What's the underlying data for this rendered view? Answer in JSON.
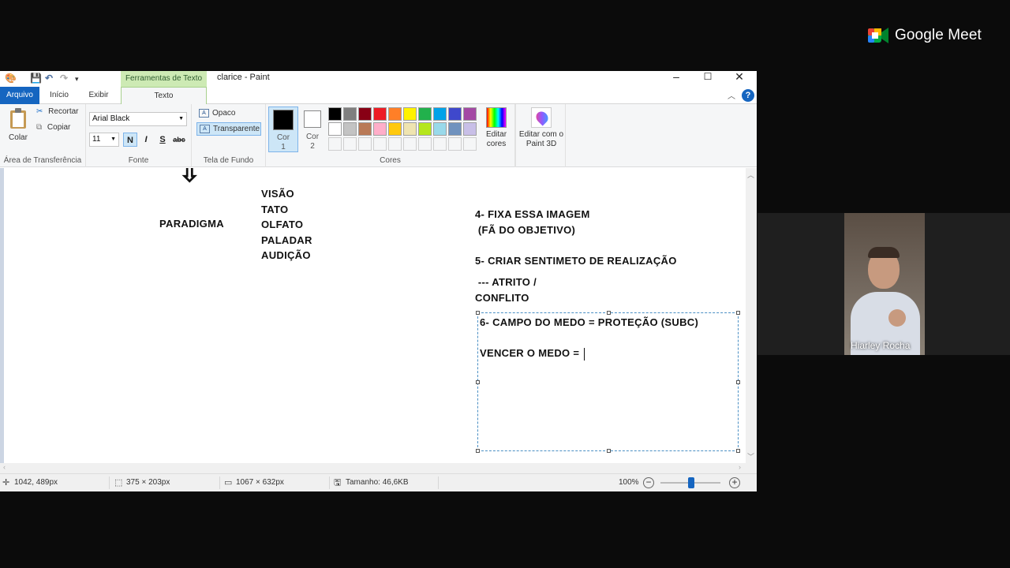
{
  "meet": {
    "brand": "Google Meet",
    "participant_name": "Hiarley Rocha"
  },
  "window": {
    "title": "clarice - Paint",
    "context_tab": "Ferramentas de Texto"
  },
  "tabs": {
    "file": "Arquivo",
    "home": "Início",
    "view": "Exibir",
    "text": "Texto"
  },
  "clipboard": {
    "paste": "Colar",
    "cut": "Recortar",
    "copy": "Copiar",
    "group_label": "Área de Transferência"
  },
  "font": {
    "family": "Arial Black",
    "size": "11",
    "bold": "N",
    "italic": "I",
    "underline": "S",
    "strike": "abc",
    "group_label": "Fonte"
  },
  "background": {
    "opaque": "Opaco",
    "transparent": "Transparente",
    "group_label": "Tela de Fundo"
  },
  "colors": {
    "color1_label": "Cor",
    "color1_num": "1",
    "color1_value": "#000000",
    "color2_label": "Cor",
    "color2_num": "2",
    "color2_value": "#ffffff",
    "group_label": "Cores",
    "edit_colors": "Editar cores",
    "paint3d": "Editar com o Paint 3D",
    "palette": [
      "#000000",
      "#7f7f7f",
      "#880015",
      "#ed1c24",
      "#ff7f27",
      "#fff200",
      "#22b14c",
      "#00a2e8",
      "#3f48cc",
      "#a349a4",
      "#ffffff",
      "#c3c3c3",
      "#b97a57",
      "#ffaec9",
      "#ffc90e",
      "#efe4b0",
      "#b5e61d",
      "#99d9ea",
      "#7092be",
      "#c8bfe7"
    ]
  },
  "canvas": {
    "arrow": "⇩",
    "paradigma": "PARADIGMA",
    "senses": [
      "VISÃO",
      "TATO",
      "OLFATO",
      "PALADAR",
      "AUDIÇÃO"
    ],
    "item4_line1": "4- FIXA ESSA IMAGEM",
    "item4_line2": " (FÃ DO OBJETIVO)",
    "item5": "5- CRIAR SENTIMETO DE REALIZAÇÃO",
    "atrito_line1": " --- ATRITO /",
    "atrito_line2": "CONFLITO",
    "item6": "6- CAMPO DO MEDO = PROTEÇÃO (SUBC)",
    "vencer": "VENCER O MEDO = "
  },
  "status": {
    "cursor_pos": "1042, 489px",
    "selection_size": "375 × 203px",
    "image_size": "1067 × 632px",
    "file_size": "Tamanho: 46,6KB",
    "zoom": "100%"
  }
}
